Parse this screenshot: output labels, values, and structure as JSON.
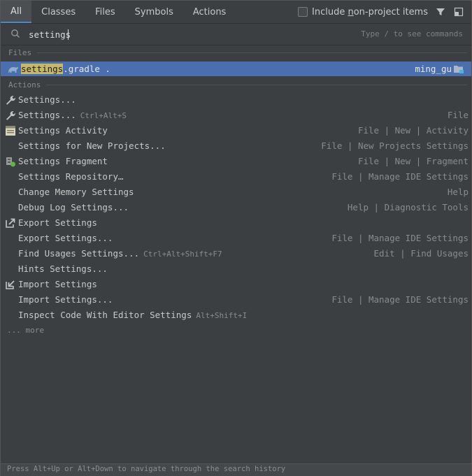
{
  "tabs": [
    "All",
    "Classes",
    "Files",
    "Symbols",
    "Actions"
  ],
  "include_checkbox": {
    "pre": "Include ",
    "underlined": "n",
    "post": "on-project items",
    "checked": false
  },
  "search": {
    "value": "settings",
    "hint": "Type / to see commands"
  },
  "sections": {
    "files": "Files",
    "actions": "Actions"
  },
  "file_result": {
    "match": "settings",
    "rest": ".gradle .",
    "location": "ming_gu"
  },
  "actions": [
    {
      "icon": "wrench-icon",
      "title": "Settings...",
      "shortcut": "",
      "group": ""
    },
    {
      "icon": "wrench-icon",
      "title": "Settings...",
      "shortcut": "Ctrl+Alt+S",
      "group": "File"
    },
    {
      "icon": "activity-icon",
      "title": "Settings Activity",
      "shortcut": "",
      "group": "File | New | Activity"
    },
    {
      "icon": "",
      "title": "Settings for New Projects...",
      "shortcut": "",
      "group": "File | New Projects Settings"
    },
    {
      "icon": "fragment-icon",
      "title": "Settings Fragment",
      "shortcut": "",
      "group": "File | New | Fragment"
    },
    {
      "icon": "",
      "title": "Settings Repository…",
      "shortcut": "",
      "group": "File | Manage IDE Settings"
    },
    {
      "icon": "",
      "title": "Change Memory Settings",
      "shortcut": "",
      "group": "Help"
    },
    {
      "icon": "",
      "title": "Debug Log Settings...",
      "shortcut": "",
      "group": "Help | Diagnostic Tools"
    },
    {
      "icon": "export-icon",
      "title": "Export Settings",
      "shortcut": "",
      "group": ""
    },
    {
      "icon": "",
      "title": "Export Settings...",
      "shortcut": "",
      "group": "File | Manage IDE Settings"
    },
    {
      "icon": "",
      "title": "Find Usages Settings...",
      "shortcut": "Ctrl+Alt+Shift+F7",
      "group": "Edit | Find Usages"
    },
    {
      "icon": "",
      "title": "Hints Settings...",
      "shortcut": "",
      "group": ""
    },
    {
      "icon": "import-icon",
      "title": "Import Settings",
      "shortcut": "",
      "group": ""
    },
    {
      "icon": "",
      "title": "Import Settings...",
      "shortcut": "",
      "group": "File | Manage IDE Settings"
    },
    {
      "icon": "",
      "title": "Inspect Code With Editor Settings",
      "shortcut": "Alt+Shift+I",
      "group": ""
    }
  ],
  "more_label": "... more",
  "footer_hint": "Press Alt+Up or Alt+Down to navigate through the search history",
  "colors": {
    "selection": "#4b6eaf",
    "match_highlight": "#c6b86b",
    "background": "#3c3f41"
  }
}
